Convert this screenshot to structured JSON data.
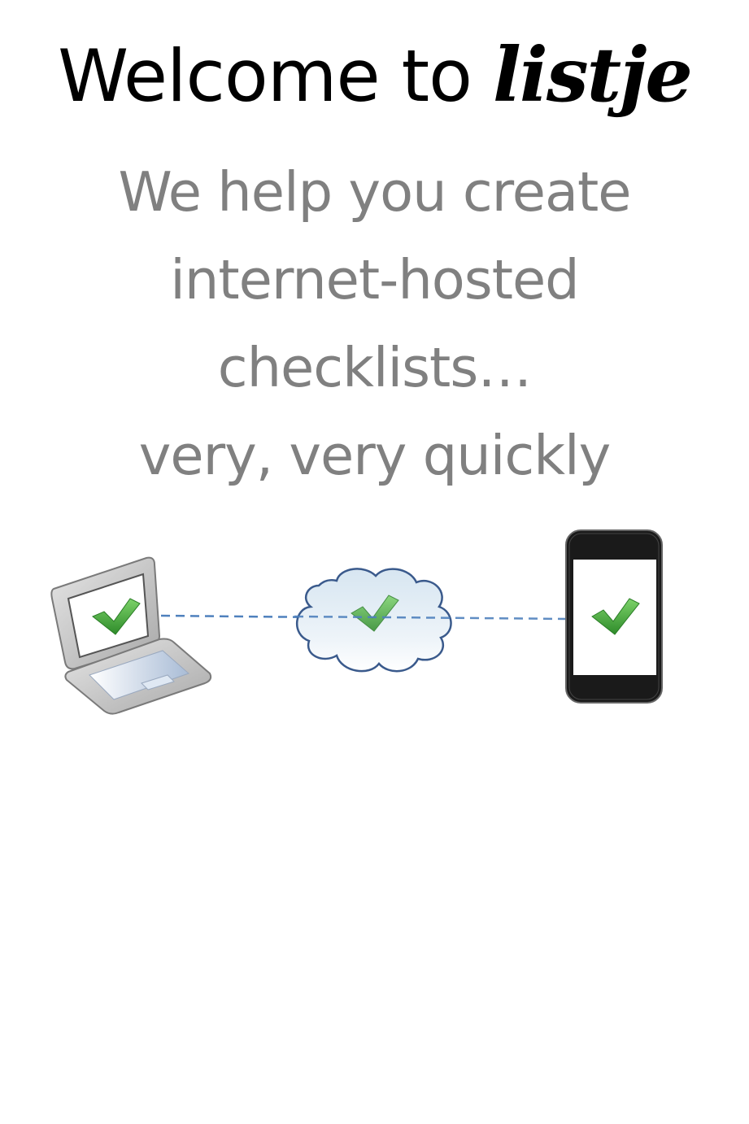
{
  "header": {
    "welcome_text": "Welcome to",
    "brand": "listje"
  },
  "tagline": {
    "lines": [
      "We help you create",
      "internet-hosted",
      "checklists…",
      "very, very quickly"
    ]
  },
  "colors": {
    "title": "#000000",
    "tagline": "#808080",
    "connector": "#4f81bd",
    "check": "#4caf3c",
    "cloud_outline": "#3a5a8c"
  },
  "illustration": {
    "devices": [
      "laptop-icon",
      "cloud-icon",
      "smartphone-icon"
    ],
    "status_icon": "checkmark-icon"
  }
}
